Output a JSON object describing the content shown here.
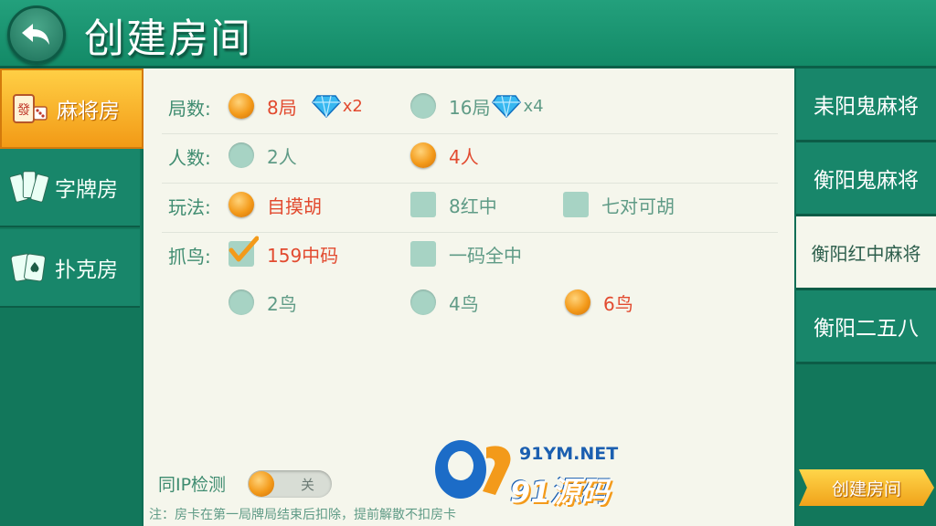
{
  "header": {
    "title": "创建房间"
  },
  "left_nav": [
    {
      "label": "麻将房",
      "icon": "mahjong-tile-icon",
      "active": true
    },
    {
      "label": "字牌房",
      "icon": "zipai-cards-icon",
      "active": false
    },
    {
      "label": "扑克房",
      "icon": "poker-cards-icon",
      "active": false
    }
  ],
  "rows": {
    "rounds": {
      "label": "局数:",
      "options": [
        {
          "text": "8局",
          "cost": "x2",
          "selected": true
        },
        {
          "text": "16局",
          "cost": "x4",
          "selected": false
        }
      ]
    },
    "players": {
      "label": "人数:",
      "options": [
        {
          "text": "2人",
          "selected": false
        },
        {
          "text": "4人",
          "selected": true
        }
      ]
    },
    "rules": {
      "label": "玩法:",
      "options": [
        {
          "text": "自摸胡",
          "selected": true
        },
        {
          "text": "8红中",
          "selected": false
        },
        {
          "text": "七对可胡",
          "selected": false
        }
      ]
    },
    "birds": {
      "label": "抓鸟:",
      "options": [
        {
          "text": "159中码",
          "selected": true
        },
        {
          "text": "一码全中",
          "selected": false
        },
        {
          "text": "2鸟",
          "selected": false
        },
        {
          "text": "4鸟",
          "selected": false
        },
        {
          "text": "6鸟",
          "selected": true
        }
      ]
    }
  },
  "ip_check": {
    "label": "同IP检测",
    "state": "关"
  },
  "note": "注：房卡在第一局牌局结束后扣除，提前解散不扣房卡",
  "right_nav": [
    {
      "label": "耒阳鬼麻将",
      "active": false
    },
    {
      "label": "衡阳鬼麻将",
      "active": false
    },
    {
      "label": "衡阳红中麻将",
      "active": true
    },
    {
      "label": "衡阳二五八",
      "active": false
    }
  ],
  "create_button": "创建房间",
  "watermark": {
    "url": "91YM.NET",
    "name": "91源码"
  },
  "colors": {
    "accent": "#f39a1a",
    "selected_text": "#e24a2f",
    "panel": "#f5f6ec",
    "theme": "#18866a"
  }
}
